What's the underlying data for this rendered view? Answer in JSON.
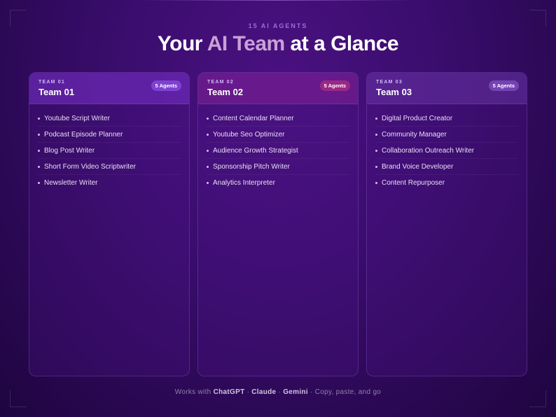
{
  "header": {
    "eyebrow": "15 AI AGENTS",
    "title_prefix": "Your ",
    "title_accent": "AI Team",
    "title_suffix": " at a Glance"
  },
  "teams": [
    {
      "kicker": "TEAM 01",
      "name": "Team 01",
      "badge": "5 Agents",
      "agents": [
        "Youtube Script Writer",
        "Podcast Episode Planner",
        "Blog Post Writer",
        "Short Form Video Scriptwriter",
        "Newsletter Writer"
      ]
    },
    {
      "kicker": "TEAM 02",
      "name": "Team 02",
      "badge": "5 Agents",
      "agents": [
        "Content Calendar Planner",
        "Youtube Seo Optimizer",
        "Audience Growth Strategist",
        "Sponsorship Pitch Writer",
        "Analytics Interpreter"
      ]
    },
    {
      "kicker": "TEAM 03",
      "name": "Team 03",
      "badge": "5 Agents",
      "agents": [
        "Digital Product Creator",
        "Community Manager",
        "Collaboration Outreach Writer",
        "Brand Voice Developer",
        "Content Repurposer"
      ]
    }
  ],
  "footer": {
    "prefix": "Works with ",
    "model_1": "ChatGPT",
    "sep_1": " · ",
    "model_2": "Claude",
    "sep_2": " · ",
    "model_3": "Gemini",
    "suffix": " · Copy, paste, and go"
  },
  "colors": {
    "background": "#3a0d6e",
    "accent": "#c9a0d8",
    "eyebrow": "#9d6be0"
  }
}
